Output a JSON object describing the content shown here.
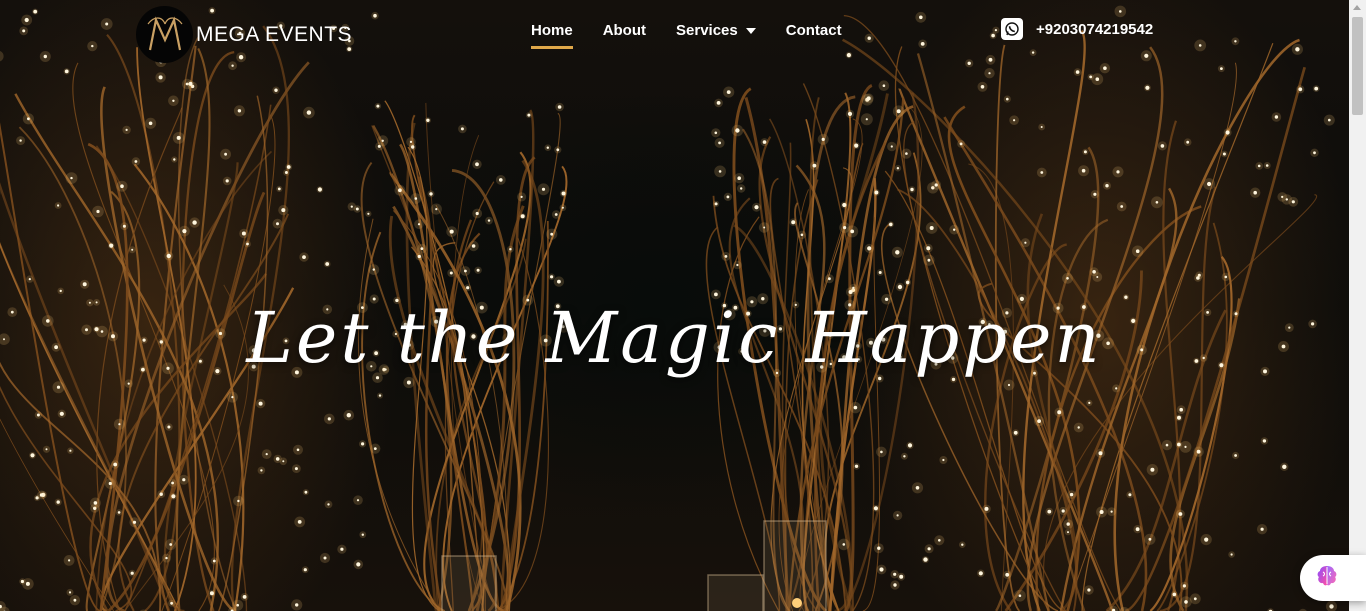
{
  "brand": {
    "name": "MEGA EVENTS",
    "logo_monogram": "M"
  },
  "nav": {
    "items": [
      {
        "label": "Home",
        "active": true
      },
      {
        "label": "About",
        "active": false
      },
      {
        "label": "Services",
        "active": false,
        "has_dropdown": true
      },
      {
        "label": "Contact",
        "active": false
      }
    ]
  },
  "contact": {
    "phone": "+9203074219542",
    "icon": "whatsapp-icon"
  },
  "hero": {
    "headline": "Let the Magic Happen"
  },
  "colors": {
    "accent": "#e0a84a",
    "text": "#ffffff",
    "background": "#0d0b09"
  },
  "assistant": {
    "icon": "brain-icon"
  }
}
